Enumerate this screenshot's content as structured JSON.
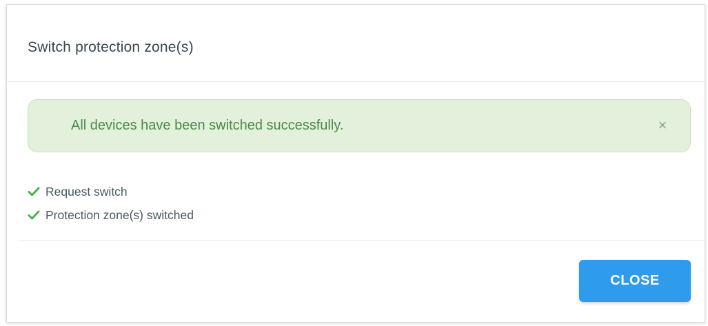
{
  "dialog": {
    "title": "Switch protection zone(s)"
  },
  "alert": {
    "message": "All devices have been switched successfully.",
    "close_glyph": "×",
    "color": "#e3f1dc",
    "text_color": "#4a8a45"
  },
  "steps": [
    {
      "label": "Request switch",
      "status": "done",
      "icon": "check-icon"
    },
    {
      "label": "Protection zone(s) switched",
      "status": "done",
      "icon": "check-icon"
    }
  ],
  "footer": {
    "close_label": "CLOSE",
    "button_color": "#2e9bec"
  }
}
